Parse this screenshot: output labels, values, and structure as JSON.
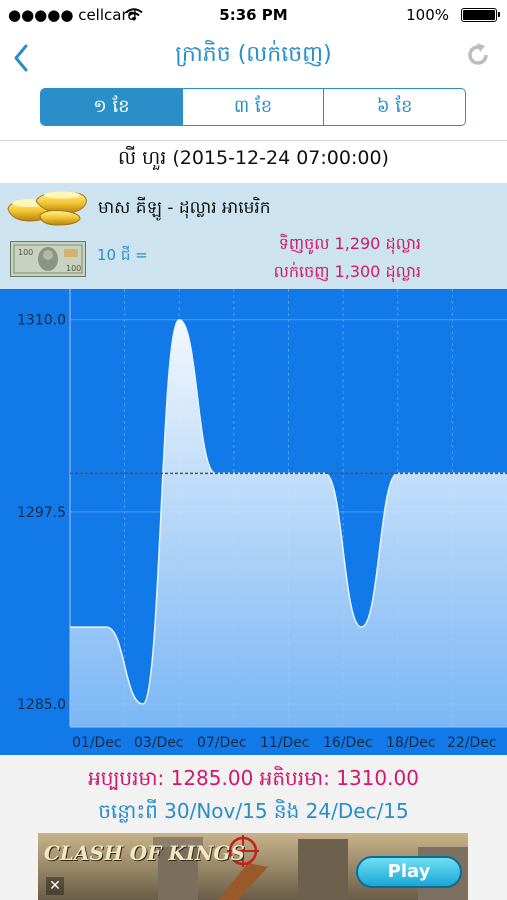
{
  "status_bar": {
    "carrier": "●●●●● cellcard",
    "time": "5:36 PM",
    "battery": "100%"
  },
  "nav": {
    "title": "ក្រាភិច (លក់ចេញ)"
  },
  "tabs": [
    {
      "label": "១ ខែ",
      "active": true
    },
    {
      "label": "៣ ខែ",
      "active": false
    },
    {
      "label": "៦ ខែ",
      "active": false
    }
  ],
  "datetime": "លី ហួរ (2015-12-24 07:00:00)",
  "info": {
    "gold_name": "មាស គីឡូ - ដុល្លារ អាមេរិក",
    "per_unit": "10 ជី =",
    "buy": "ទិញចូល 1,290 ដុល្លារ",
    "sell": "លក់ចេញ 1,300 ដុល្លារ"
  },
  "chart_data": {
    "type": "area",
    "x_ticks": [
      "01/Dec",
      "03/Dec",
      "07/Dec",
      "11/Dec",
      "16/Dec",
      "18/Dec",
      "22/Dec"
    ],
    "y_ticks": [
      "1310.0",
      "1297.5",
      "1285.0"
    ],
    "ylim": [
      1283.5,
      1312
    ],
    "reference_line": 1300,
    "grid": true,
    "x": [
      "01/Dec",
      "03/Dec",
      "05/Dec",
      "07/Dec",
      "09/Dec",
      "11/Dec",
      "13/Dec",
      "14/Dec",
      "16/Dec",
      "18/Dec",
      "20/Dec",
      "22/Dec",
      "24/Dec"
    ],
    "values": [
      1290,
      1290,
      1285,
      1310,
      1300,
      1300,
      1300,
      1300,
      1290,
      1300,
      1300,
      1300,
      1300
    ],
    "colors": {
      "background": "#1279e8",
      "fill_top": "#ffffff",
      "fill_bottom": "#8ec2f7"
    }
  },
  "footer": {
    "minmax": "អប្បបរមា: 1285.00 អតិបរមា: 1310.00",
    "range": "ចន្លោះពី 30/Nov/15 និង 24/Dec/15"
  },
  "ad": {
    "brand": "CLASH OF KINGS",
    "play": "Play",
    "close": "✕"
  }
}
